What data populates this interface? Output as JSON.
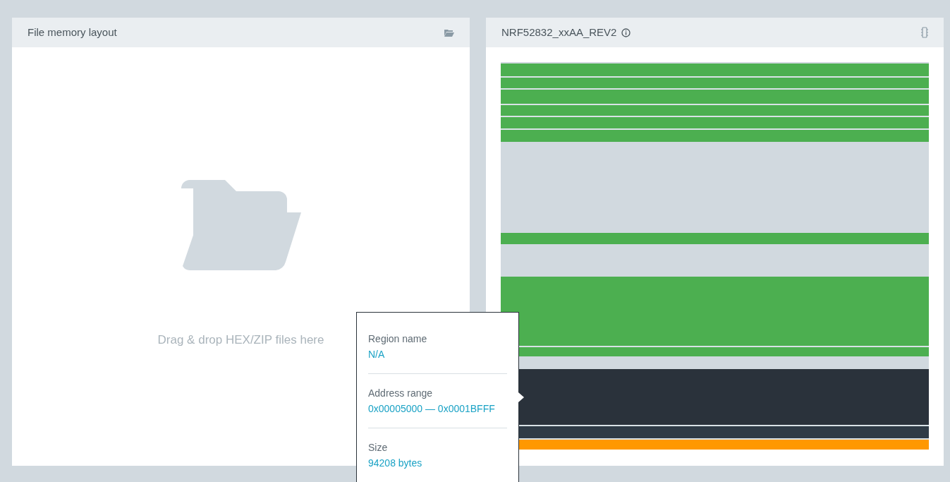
{
  "file_panel": {
    "title": "File memory layout",
    "drop_hint": "Drag & drop HEX/ZIP files here"
  },
  "device_panel": {
    "title": "NRF52832_xxAA_REV2",
    "segments": [
      {
        "kind": "free"
      },
      {
        "kind": "used"
      },
      {
        "kind": "used"
      },
      {
        "kind": "used"
      },
      {
        "kind": "used"
      },
      {
        "kind": "used"
      },
      {
        "kind": "used"
      },
      {
        "kind": "free"
      },
      {
        "kind": "used"
      },
      {
        "kind": "free"
      },
      {
        "kind": "used"
      },
      {
        "kind": "used"
      },
      {
        "kind": "free"
      },
      {
        "kind": "selected"
      },
      {
        "kind": "dark"
      },
      {
        "kind": "orange"
      }
    ]
  },
  "tooltip": {
    "fields": [
      {
        "label": "Region name",
        "value": "N/A"
      },
      {
        "label": "Address range",
        "value": "0x00005000 — 0x0001BFFF"
      },
      {
        "label": "Size",
        "value": "94208 bytes"
      }
    ]
  }
}
